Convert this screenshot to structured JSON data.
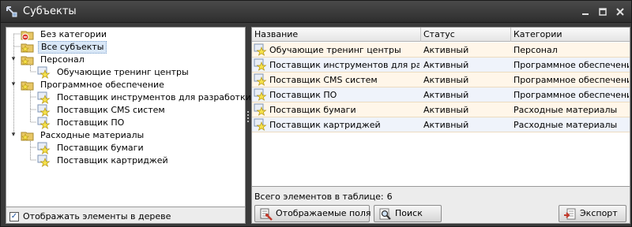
{
  "window": {
    "title": "Субъекты"
  },
  "tree": {
    "items": [
      {
        "label": "Без категории"
      },
      {
        "label": "Все субъекты"
      },
      {
        "label": "Персонал"
      },
      {
        "label": "Обучающие тренинг центры"
      },
      {
        "label": "Программное обеспечение"
      },
      {
        "label": "Поставщик инструментов для разработки ПО"
      },
      {
        "label": "Поставщик CMS систем"
      },
      {
        "label": "Поставщик ПО"
      },
      {
        "label": "Расходные материалы"
      },
      {
        "label": "Поставщик бумаги"
      },
      {
        "label": "Поставщик картриджей"
      }
    ],
    "show_in_tree_label": "Отображать элементы в дереве",
    "show_in_tree_checked": true
  },
  "grid": {
    "columns": [
      "Название",
      "Статус",
      "Категории"
    ],
    "rows": [
      [
        "Обучающие тренинг центры",
        "Активный",
        "Персонал"
      ],
      [
        "Поставщик инструментов для разработки ПО",
        "Активный",
        "Программное обеспечение"
      ],
      [
        "Поставщик CMS систем",
        "Активный",
        "Программное обеспечение"
      ],
      [
        "Поставщик ПО",
        "Активный",
        "Программное обеспечение"
      ],
      [
        "Поставщик бумаги",
        "Активный",
        "Расходные материалы"
      ],
      [
        "Поставщик картриджей",
        "Активный",
        "Расходные материалы"
      ]
    ],
    "total_label": "Всего элементов в таблице:",
    "total_count": "6"
  },
  "buttons": {
    "fields": "Отображаемые поля",
    "search": "Поиск",
    "export": "Экспорт"
  },
  "colors": {
    "row_odd": "#fff6e9",
    "row_even": "#eff3fb",
    "selection": "#d9e7f7"
  }
}
